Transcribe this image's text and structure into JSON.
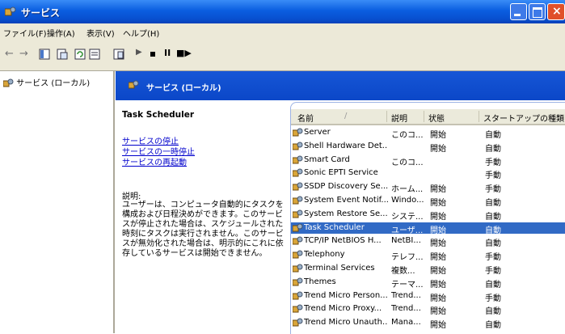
{
  "window": {
    "title": "サービス"
  },
  "menu": {
    "items": [
      "ファイル(F)",
      "操作(A)",
      "表示(V)",
      "ヘルプ(H)"
    ]
  },
  "tree": {
    "root_label": "サービス (ローカル)"
  },
  "panel_header": {
    "title": "サービス (ローカル)"
  },
  "description": {
    "service_name": "Task Scheduler",
    "links": [
      "サービスの停止",
      "サービスの一時停止",
      "サービスの再起動"
    ],
    "desc_label": "説明:",
    "desc_text": "ユーザーは、コンピュータ自動的にタスクを構成および日程決めができます。このサービスが停止された場合は、スケジュールされた時刻にタスクは実行されません。このサービスが無効化された場合は、明示的にこれに依存しているサービスは開始できません。"
  },
  "list": {
    "headers": [
      "名前",
      "説明",
      "状態",
      "スタートアップの種類"
    ],
    "rows": [
      {
        "name": "Server",
        "desc": "このコ...",
        "status": "開始",
        "startup": "自動"
      },
      {
        "name": "Shell Hardware Det...",
        "desc": "",
        "status": "開始",
        "startup": "自動"
      },
      {
        "name": "Smart Card",
        "desc": "このコ...",
        "status": "",
        "startup": "手動"
      },
      {
        "name": "Sonic EPTI Service",
        "desc": "",
        "status": "",
        "startup": "手動"
      },
      {
        "name": "SSDP Discovery Se...",
        "desc": "ホーム...",
        "status": "開始",
        "startup": "手動"
      },
      {
        "name": "System Event Notif...",
        "desc": "Windo...",
        "status": "開始",
        "startup": "自動"
      },
      {
        "name": "System Restore Se...",
        "desc": "システ...",
        "status": "開始",
        "startup": "自動"
      },
      {
        "name": "Task Scheduler",
        "desc": "ユーザ...",
        "status": "開始",
        "startup": "自動",
        "selected": true
      },
      {
        "name": "TCP/IP NetBIOS H...",
        "desc": "NetBI...",
        "status": "開始",
        "startup": "自動"
      },
      {
        "name": "Telephony",
        "desc": "テレフ...",
        "status": "開始",
        "startup": "手動"
      },
      {
        "name": "Terminal Services",
        "desc": "複数...",
        "status": "開始",
        "startup": "手動"
      },
      {
        "name": "Themes",
        "desc": "テーマ...",
        "status": "開始",
        "startup": "自動"
      },
      {
        "name": "Trend Micro Person...",
        "desc": "Trend...",
        "status": "開始",
        "startup": "手動"
      },
      {
        "name": "Trend Micro Proxy...",
        "desc": "Trend...",
        "status": "開始",
        "startup": "自動"
      },
      {
        "name": "Trend Micro Unauth...",
        "desc": "Mana...",
        "status": "開始",
        "startup": "自動"
      }
    ]
  },
  "colors": {
    "titlebar": "#0a5ee0",
    "selection": "#316ac5",
    "header_band": "#0b47c8",
    "link": "#0000cc"
  }
}
